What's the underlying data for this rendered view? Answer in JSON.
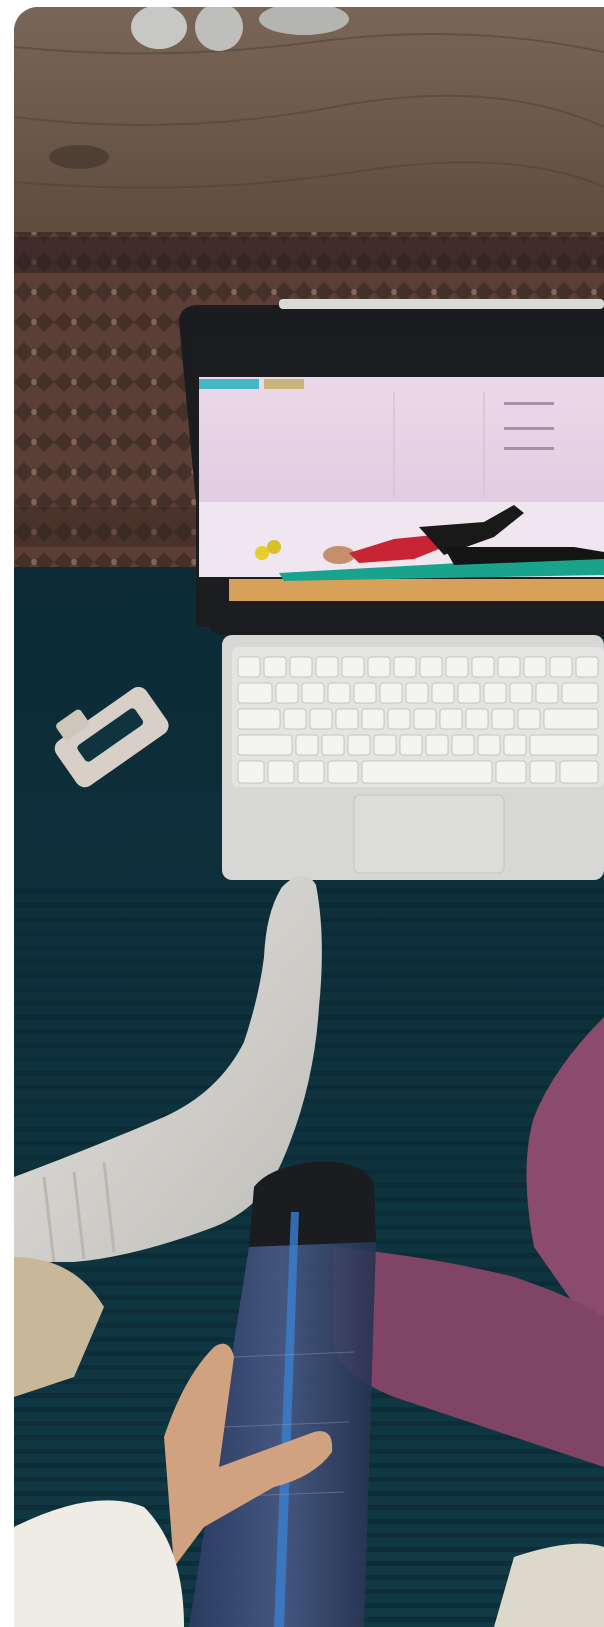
{
  "photo": {
    "description_icon": "image-icon",
    "alt": ""
  },
  "colors": {
    "wood": "#6b5a4c",
    "rug": "#5a3d34",
    "mat": "#0f3440",
    "laptop": "#cfd0cf",
    "screen_wall": "#e7d6e7",
    "yoga_mat_teal": "#1aa38c",
    "resistance_band": "#8a4b6f",
    "sock": "#d9d7d2",
    "bottle": "#1f2c4d"
  }
}
